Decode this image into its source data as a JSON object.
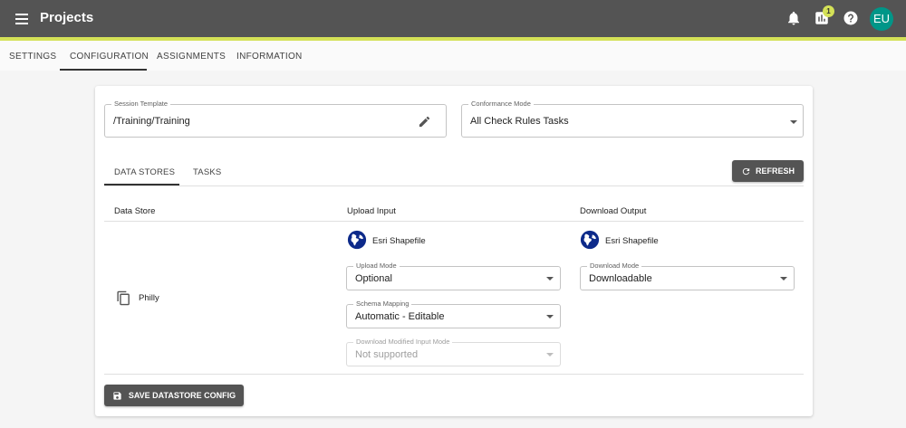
{
  "app": {
    "title": "Projects",
    "notification_badge": "1",
    "avatar_initials": "EU",
    "colors": {
      "header": "#545454",
      "accent": "#d4e157",
      "avatar": "#009688",
      "badge": "#d4e157"
    }
  },
  "tabs": [
    {
      "label": "SETTINGS"
    },
    {
      "label": "CONFIGURATION",
      "active": true
    },
    {
      "label": "ASSIGNMENTS"
    },
    {
      "label": "INFORMATION"
    }
  ],
  "session_template": {
    "label": "Session Template",
    "value": "/Training/Training"
  },
  "conformance_mode": {
    "label": "Conformance Mode",
    "value": "All Check Rules Tasks"
  },
  "subtabs": [
    {
      "label": "DATA STORES",
      "active": true
    },
    {
      "label": "TASKS"
    }
  ],
  "refresh_label": "REFRESH",
  "table": {
    "columns": [
      "Data Store",
      "Upload Input",
      "Download Output"
    ],
    "row": {
      "data_store": "Philly",
      "upload_format": "Esri Shapefile",
      "download_format": "Esri Shapefile",
      "upload_mode": {
        "label": "Upload Mode",
        "value": "Optional"
      },
      "schema_mapping": {
        "label": "Schema Mapping",
        "value": "Automatic - Editable"
      },
      "download_modified": {
        "label": "Download Modified Input Mode",
        "value": "Not supported"
      },
      "download_mode": {
        "label": "Download Mode",
        "value": "Downloadable"
      }
    }
  },
  "save_label": "SAVE DATASTORE CONFIG",
  "icons": {
    "menu": "menu-icon",
    "bell": "bell-icon",
    "stats": "bar-chart-icon",
    "help": "help-icon",
    "edit": "pencil-icon",
    "refresh": "refresh-icon",
    "copy": "copy-icon",
    "globe": "globe-icon",
    "save": "floppy-disk-icon"
  }
}
